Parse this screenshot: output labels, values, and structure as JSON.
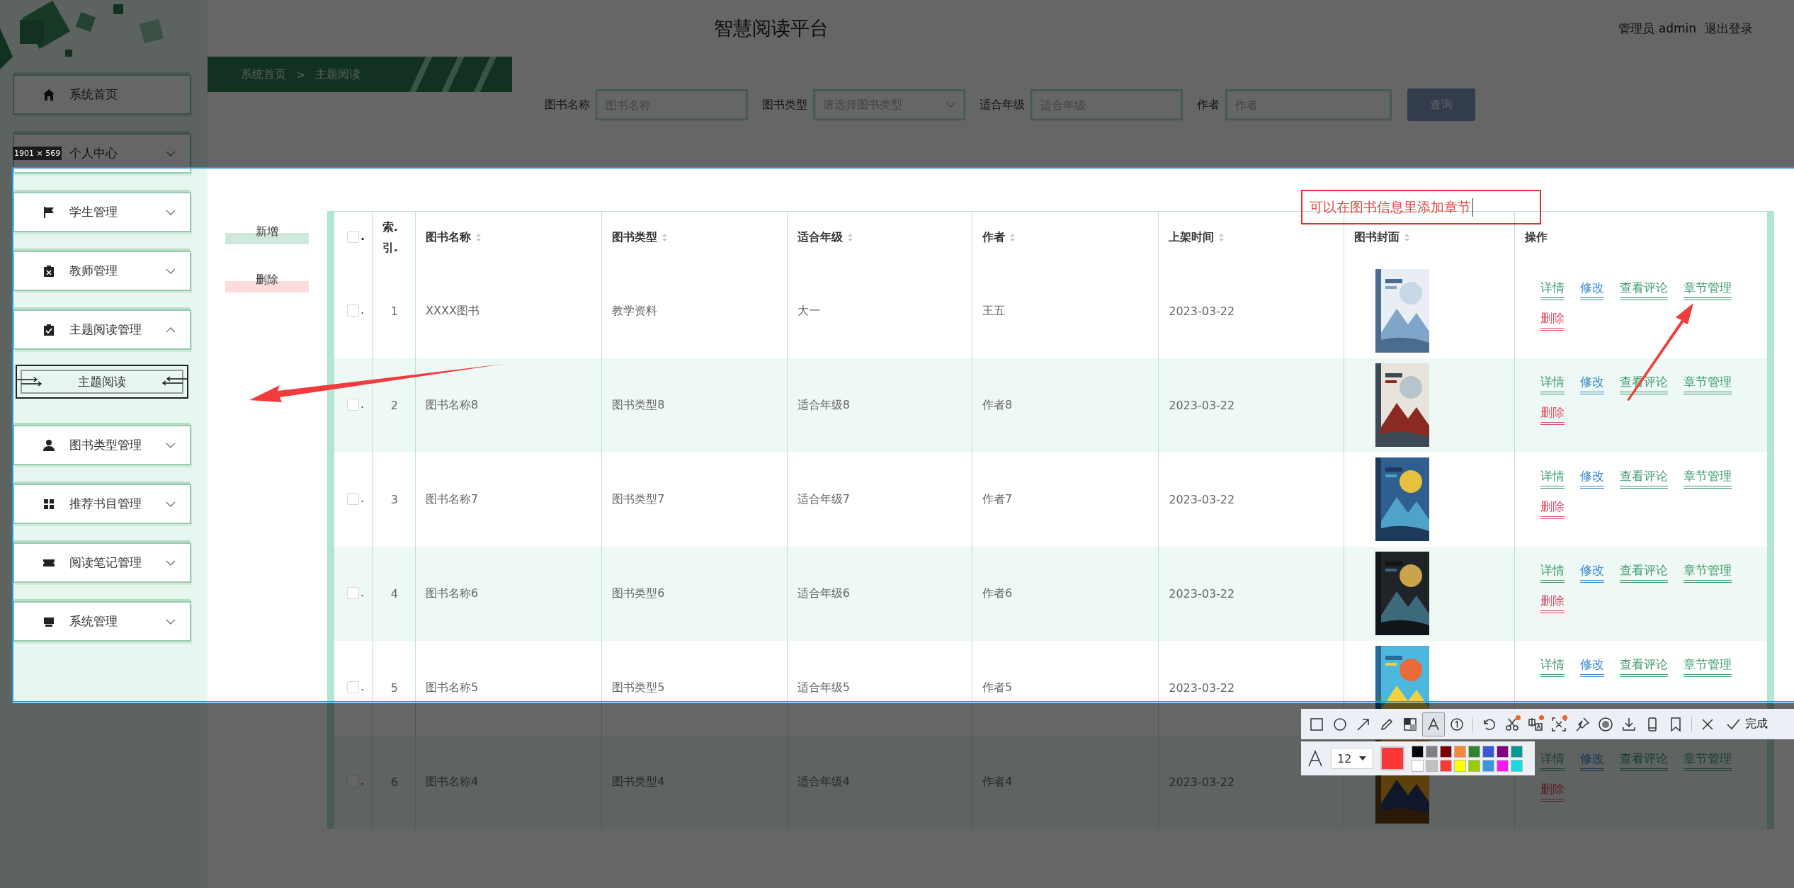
{
  "header": {
    "title": "智慧阅读平台",
    "user": "管理员 admin",
    "logout": "退出登录"
  },
  "sidebar": {
    "items": [
      {
        "label": "系统首页",
        "kind": "link"
      },
      {
        "label": "个人中心",
        "kind": "group",
        "expanded": false
      },
      {
        "label": "学生管理",
        "kind": "group",
        "expanded": false
      },
      {
        "label": "教师管理",
        "kind": "group",
        "expanded": false
      },
      {
        "label": "主题阅读管理",
        "kind": "group",
        "expanded": true,
        "children": [
          {
            "label": "主题阅读",
            "selected": true
          }
        ]
      },
      {
        "label": "图书类型管理",
        "kind": "group",
        "expanded": false
      },
      {
        "label": "推荐书目管理",
        "kind": "group",
        "expanded": false
      },
      {
        "label": "阅读笔记管理",
        "kind": "group",
        "expanded": false
      },
      {
        "label": "系统管理",
        "kind": "group",
        "expanded": false
      }
    ]
  },
  "breadcrumb": {
    "items": [
      "系统首页",
      "主题阅读"
    ],
    "separator": ">"
  },
  "search": {
    "fields": [
      {
        "label": "图书名称",
        "placeholder": "图书名称",
        "kind": "input"
      },
      {
        "label": "图书类型",
        "placeholder": "请选择图书类型",
        "kind": "select"
      },
      {
        "label": "适合年级",
        "placeholder": "适合年级",
        "kind": "input"
      },
      {
        "label": "作者",
        "placeholder": "作者",
        "kind": "input"
      }
    ],
    "button": "查询"
  },
  "actions": [
    {
      "label": "新增",
      "kind": "add"
    },
    {
      "label": "删除",
      "kind": "delete"
    }
  ],
  "table": {
    "header_check": {
      "checked": false,
      "check_label": "."
    },
    "columns": [
      {
        "label": "索.引.",
        "sortable": false
      },
      {
        "label": "图书名称",
        "sortable": true
      },
      {
        "label": "图书类型",
        "sortable": true
      },
      {
        "label": "适合年级",
        "sortable": true
      },
      {
        "label": "作者",
        "sortable": true
      },
      {
        "label": "上架时间",
        "sortable": true
      },
      {
        "label": "图书封面",
        "sortable": true
      },
      {
        "label": "操作",
        "sortable": false
      }
    ],
    "rows": [
      {
        "checked": false,
        "check_label": ".",
        "index": "1",
        "name": "XXXX图书",
        "type": "教学资料",
        "grade": "大一",
        "author": "王五",
        "date": "2023-03-22",
        "actions": [
          {
            "label": "详情",
            "kind": "view"
          },
          {
            "label": "修改",
            "kind": "edit"
          },
          {
            "label": "查看评论",
            "kind": "view"
          },
          {
            "label": "章节管理",
            "kind": "view"
          },
          {
            "label": "删除",
            "kind": "delete"
          }
        ]
      },
      {
        "checked": false,
        "check_label": ".",
        "index": "2",
        "name": "图书名称8",
        "type": "图书类型8",
        "grade": "适合年级8",
        "author": "作者8",
        "date": "2023-03-22",
        "actions": [
          {
            "label": "详情",
            "kind": "view"
          },
          {
            "label": "修改",
            "kind": "edit"
          },
          {
            "label": "查看评论",
            "kind": "view"
          },
          {
            "label": "章节管理",
            "kind": "view"
          },
          {
            "label": "删除",
            "kind": "delete"
          }
        ]
      },
      {
        "checked": false,
        "check_label": ".",
        "index": "3",
        "name": "图书名称7",
        "type": "图书类型7",
        "grade": "适合年级7",
        "author": "作者7",
        "date": "2023-03-22",
        "actions": [
          {
            "label": "详情",
            "kind": "view"
          },
          {
            "label": "修改",
            "kind": "edit"
          },
          {
            "label": "查看评论",
            "kind": "view"
          },
          {
            "label": "章节管理",
            "kind": "view"
          },
          {
            "label": "删除",
            "kind": "delete"
          }
        ]
      },
      {
        "checked": false,
        "check_label": ".",
        "index": "4",
        "name": "图书名称6",
        "type": "图书类型6",
        "grade": "适合年级6",
        "author": "作者6",
        "date": "2023-03-22",
        "actions": [
          {
            "label": "详情",
            "kind": "view"
          },
          {
            "label": "修改",
            "kind": "edit"
          },
          {
            "label": "查看评论",
            "kind": "view"
          },
          {
            "label": "章节管理",
            "kind": "view"
          },
          {
            "label": "删除",
            "kind": "delete"
          }
        ]
      },
      {
        "checked": false,
        "check_label": ".",
        "index": "5",
        "name": "图书名称5",
        "type": "图书类型5",
        "grade": "适合年级5",
        "author": "作者5",
        "date": "2023-03-22",
        "actions": [
          {
            "label": "详情",
            "kind": "view"
          },
          {
            "label": "修改",
            "kind": "edit"
          },
          {
            "label": "查看评论",
            "kind": "view"
          },
          {
            "label": "章节管理",
            "kind": "view"
          }
        ]
      },
      {
        "checked": false,
        "check_label": ".",
        "index": "6",
        "name": "图书名称4",
        "type": "图书类型4",
        "grade": "适合年级4",
        "author": "作者4",
        "date": "2023-03-22",
        "actions": [
          {
            "label": "详情",
            "kind": "view"
          },
          {
            "label": "修改",
            "kind": "edit"
          },
          {
            "label": "查看评论",
            "kind": "view"
          },
          {
            "label": "章节管理",
            "kind": "view"
          },
          {
            "label": "删除",
            "kind": "delete"
          }
        ]
      }
    ]
  },
  "capture": {
    "size_label": "1901 × 569",
    "note": "可以在图书信息里添加章节",
    "tools": [
      {
        "kind": "rectangle",
        "selected": false,
        "badge": false
      },
      {
        "kind": "ellipse",
        "selected": false,
        "badge": false
      },
      {
        "kind": "arrow",
        "selected": false,
        "badge": false
      },
      {
        "kind": "pencil",
        "selected": false,
        "badge": false
      },
      {
        "kind": "mosaic",
        "selected": false,
        "badge": false
      },
      {
        "kind": "text",
        "selected": true,
        "badge": false
      },
      {
        "kind": "number",
        "selected": false,
        "badge": false
      },
      {
        "kind": "undo",
        "selected": false,
        "badge": false
      },
      {
        "kind": "scissors",
        "selected": false,
        "badge": true
      },
      {
        "kind": "translate",
        "selected": false,
        "badge": true
      },
      {
        "kind": "ocr",
        "selected": false,
        "badge": true
      },
      {
        "kind": "pin",
        "selected": false,
        "badge": false
      },
      {
        "kind": "record",
        "selected": false,
        "badge": false
      },
      {
        "kind": "download",
        "selected": false,
        "badge": false
      },
      {
        "kind": "phone",
        "selected": false,
        "badge": false
      },
      {
        "kind": "bookmark",
        "selected": false,
        "badge": false
      },
      {
        "kind": "close",
        "selected": false,
        "badge": false
      }
    ],
    "done": "完成",
    "font_size": "12",
    "current": {
      "color": "#fb3838"
    },
    "palette": [
      {
        "color": "#000000"
      },
      {
        "color": "#808080"
      },
      {
        "color": "#800000"
      },
      {
        "color": "#f7883a"
      },
      {
        "color": "#308430"
      },
      {
        "color": "#385ad3"
      },
      {
        "color": "#800080"
      },
      {
        "color": "#009999"
      },
      {
        "color": "#ffffff"
      },
      {
        "color": "#c0c0c0"
      },
      {
        "color": "#fb3838"
      },
      {
        "color": "#ffff00"
      },
      {
        "color": "#99cc00"
      },
      {
        "color": "#3895e2"
      },
      {
        "color": "#f31bf3"
      },
      {
        "color": "#16dcdc"
      }
    ]
  }
}
